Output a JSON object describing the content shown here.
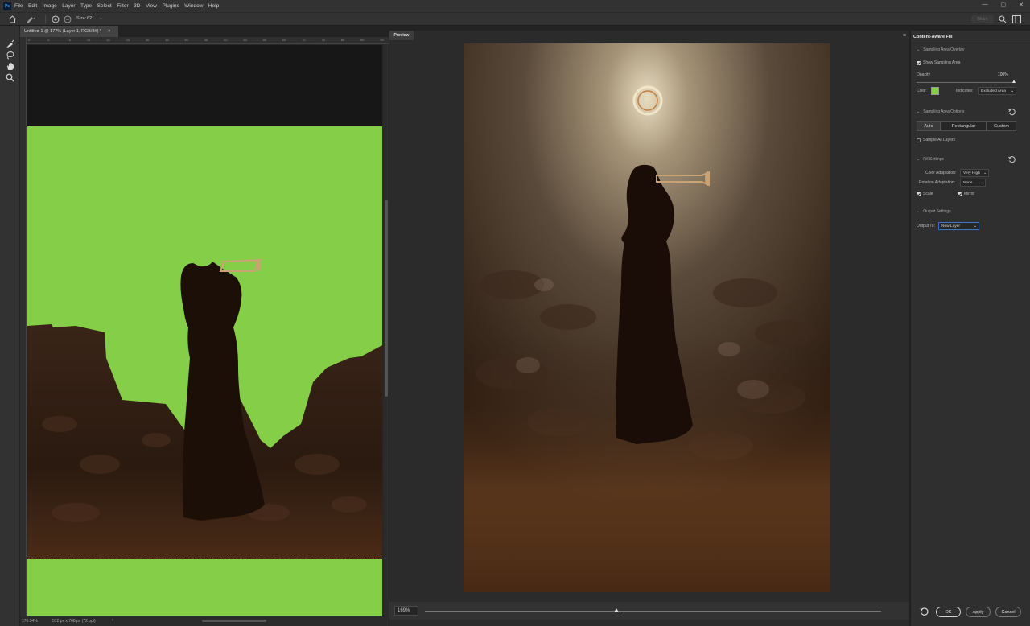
{
  "app": {
    "logo": "Ps"
  },
  "menu": [
    "File",
    "Edit",
    "Image",
    "Layer",
    "Type",
    "Select",
    "Filter",
    "3D",
    "View",
    "Plugins",
    "Window",
    "Help"
  ],
  "options_bar": {
    "size_label": "Size:",
    "size_value": "62",
    "share_label": "Share"
  },
  "document": {
    "tab_title": "Untitled-1 @ 177% (Layer 1, RGB/8#) *",
    "close_glyph": "×",
    "zoom": "176.54%",
    "dimensions": "512 px x 768 px (72 ppi)",
    "ruler_ticks": [
      "0",
      "5",
      "10",
      "15",
      "20",
      "25",
      "30",
      "35",
      "40",
      "45",
      "50",
      "55",
      "60",
      "65",
      "70",
      "75",
      "80",
      "85",
      "90"
    ]
  },
  "preview": {
    "tab_label": "Preview",
    "zoom": "169%",
    "zoom_fraction": 0.42
  },
  "panel": {
    "title": "Content-Aware Fill",
    "overlay": {
      "header": "Sampling Area Overlay",
      "show_label": "Show Sampling Area",
      "show_checked": true,
      "opacity_label": "Opacity",
      "opacity_value": "100%",
      "opacity_fraction": 1.0,
      "color_label": "Color",
      "color_swatch": "#84cf47",
      "indicates_label": "Indicates:",
      "indicates_value": "Excluded Area"
    },
    "sampling": {
      "header": "Sampling Area Options",
      "modes": [
        "Auto",
        "Rectangular",
        "Custom"
      ],
      "active_mode": "Auto",
      "sample_all_label": "Sample All Layers",
      "sample_all_checked": false
    },
    "fill": {
      "header": "Fill Settings",
      "color_adapt_label": "Color Adaptation:",
      "color_adapt_value": "Very High",
      "rotation_label": "Rotation Adaptation:",
      "rotation_value": "None",
      "scale_label": "Scale",
      "scale_checked": true,
      "mirror_label": "Mirror",
      "mirror_checked": true
    },
    "output": {
      "header": "Output Settings",
      "output_label": "Output To:",
      "output_value": "New Layer"
    },
    "buttons": {
      "ok": "OK",
      "apply": "Apply",
      "cancel": "Cancel"
    }
  }
}
